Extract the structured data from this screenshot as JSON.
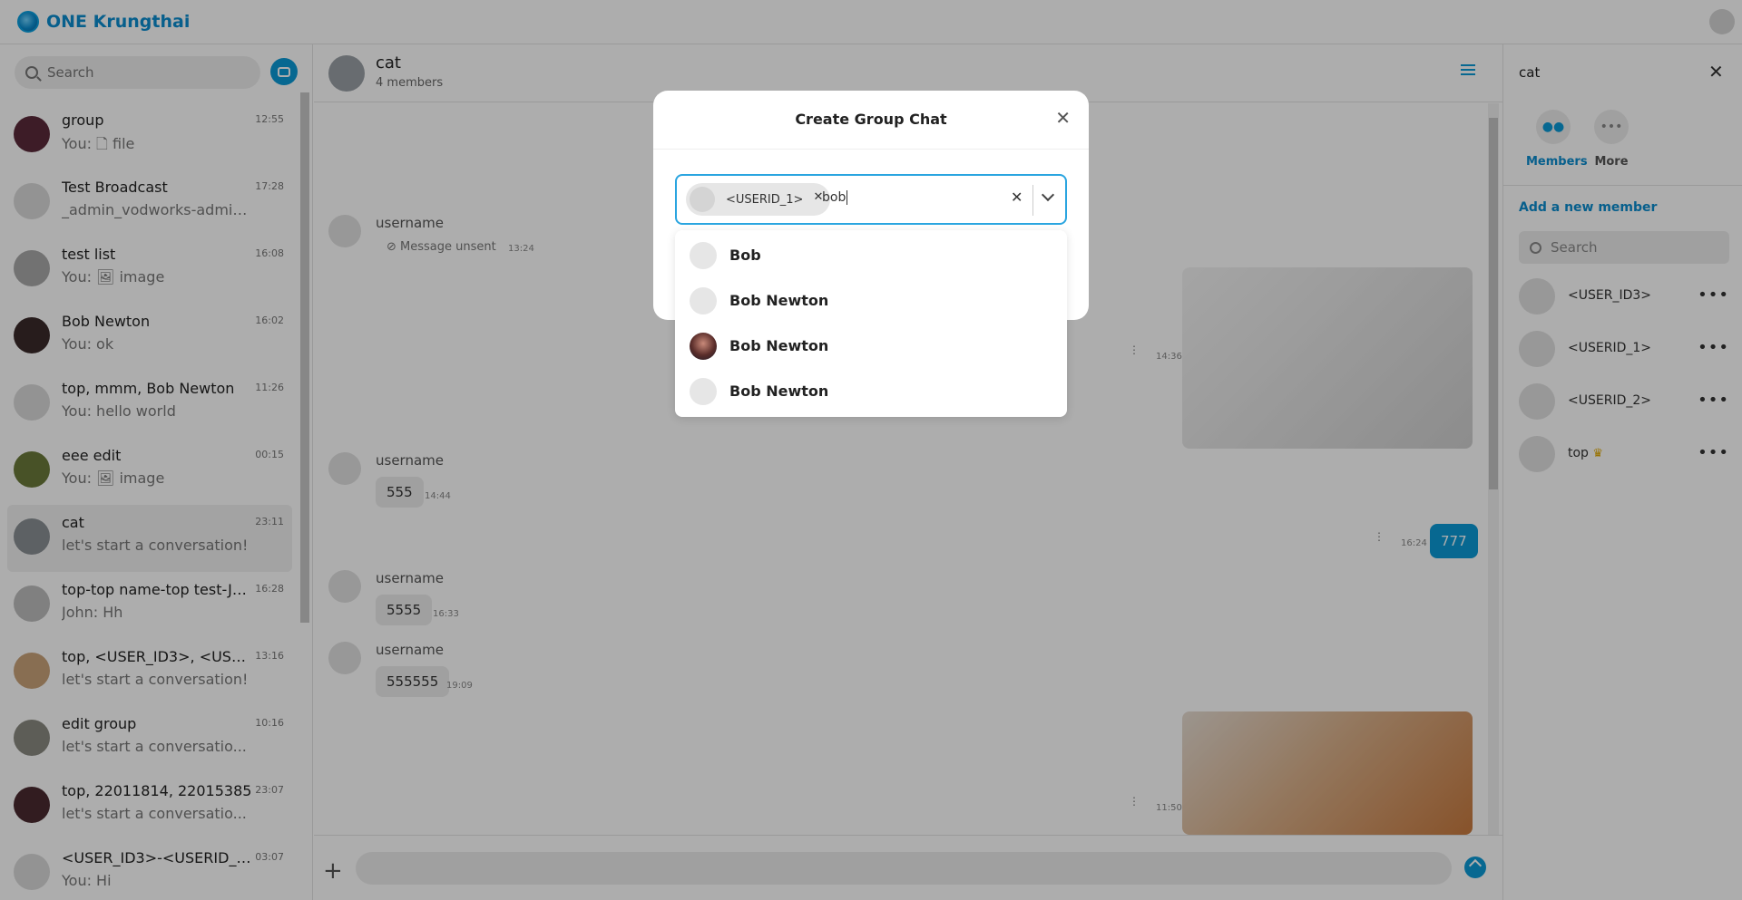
{
  "app": {
    "name": "ONE Krungthai"
  },
  "sidebar": {
    "search_placeholder": "Search",
    "conversations": [
      {
        "name": "group",
        "preview": "You: 🗋 file",
        "time": "12:55"
      },
      {
        "name": "Test Broadcast",
        "preview": "_admin_vodworks-admin: ...",
        "time": "17:28"
      },
      {
        "name": "test list",
        "preview": "You: 🖼 image",
        "time": "16:08"
      },
      {
        "name": "Bob Newton",
        "preview": "You: ok",
        "time": "16:02"
      },
      {
        "name": "top, mmm, Bob Newton",
        "preview": "You: hello world",
        "time": "11:26"
      },
      {
        "name": "eee edit",
        "preview": "You: 🖼 image",
        "time": "00:15"
      },
      {
        "name": "cat",
        "preview": "let's start a conversation!",
        "time": "23:11"
      },
      {
        "name": "top-top name-top test-Jo...",
        "preview": "John: Hh",
        "time": "16:28"
      },
      {
        "name": "top, <USER_ID3>, <USERID_...",
        "preview": "let's start a conversation!",
        "time": "13:16"
      },
      {
        "name": "edit group",
        "preview": "let's start a conversatio...",
        "time": "10:16"
      },
      {
        "name": "top, 22011814, 22015385",
        "preview": "let's start a conversatio...",
        "time": "23:07"
      },
      {
        "name": "<USER_ID3>-<USERID_1>-<...",
        "preview": "You: Hi",
        "time": "03:07"
      }
    ]
  },
  "chat": {
    "title": "cat",
    "subtitle": "4 members",
    "messages": {
      "m1_user": "username",
      "m1_unsent": "Message unsent",
      "m1_time": "13:24",
      "img1_time": "14:36",
      "m2_user": "username",
      "m2_text": "555",
      "m2_time": "14:44",
      "out1_text": "777",
      "out1_time": "16:24",
      "m3_user": "username",
      "m3_text": "5555",
      "m3_time": "16:33",
      "m4_user": "username",
      "m4_text": "555555",
      "m4_time": "19:09",
      "img2_time": "11:50"
    }
  },
  "right_panel": {
    "title": "cat",
    "tabs": [
      {
        "label": "Members"
      },
      {
        "label": "More"
      }
    ],
    "add_member": "Add a new member",
    "search_placeholder": "Search",
    "members": [
      {
        "name": "<USER_ID3>"
      },
      {
        "name": "<USERID_1>"
      },
      {
        "name": "<USERID_2>"
      },
      {
        "name": "top"
      }
    ]
  },
  "modal": {
    "title": "Create Group Chat",
    "selected_chip": "<USERID_1>",
    "typed_value": "bob",
    "options": [
      {
        "name": "Bob"
      },
      {
        "name": "Bob Newton"
      },
      {
        "name": "Bob Newton"
      },
      {
        "name": "Bob Newton"
      }
    ]
  },
  "colors": {
    "accent": "#0b9ad6",
    "brand": "#0b8ccf"
  }
}
